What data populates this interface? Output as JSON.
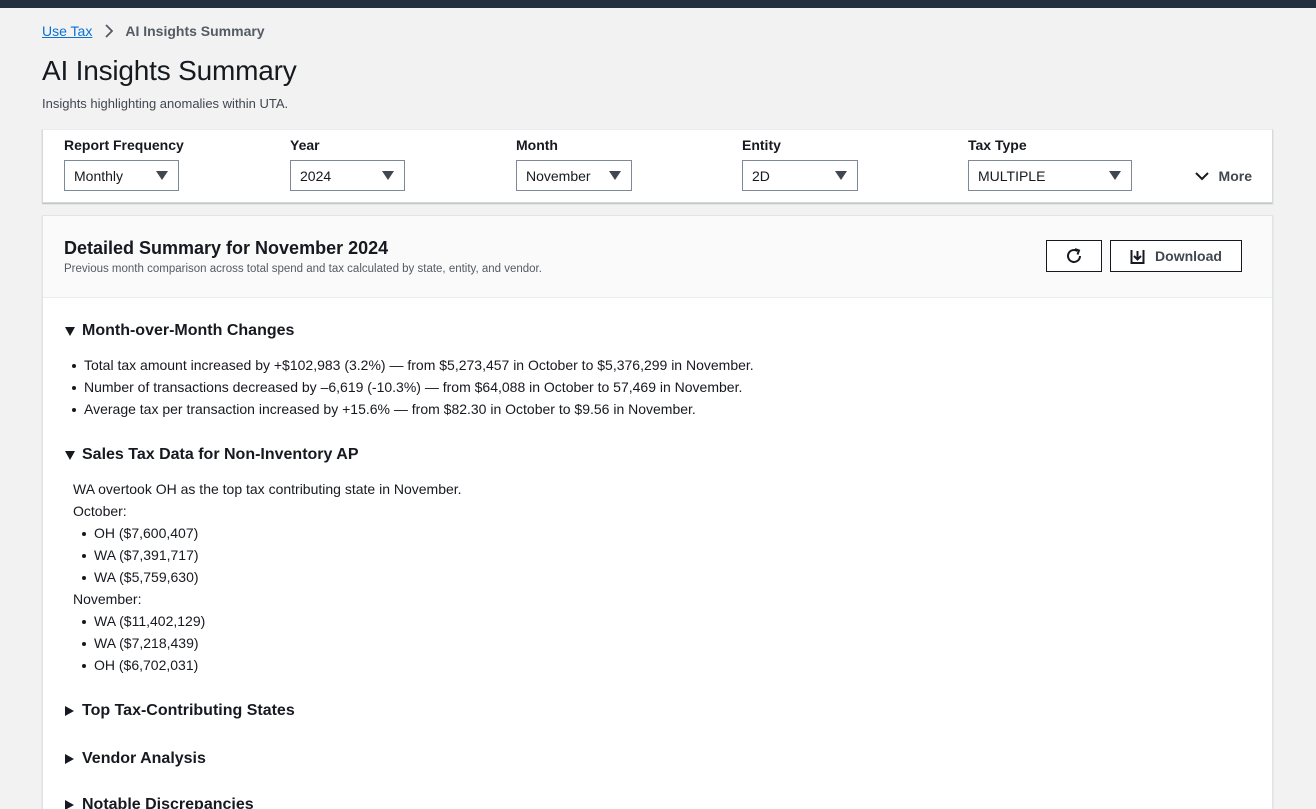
{
  "breadcrumb": {
    "parent": "Use Tax",
    "current": "AI Insights Summary"
  },
  "page": {
    "title": "AI Insights Summary",
    "description": "Insights highlighting anomalies within UTA."
  },
  "filters": {
    "report_frequency": {
      "label": "Report Frequency",
      "value": "Monthly"
    },
    "year": {
      "label": "Year",
      "value": "2024"
    },
    "month": {
      "label": "Month",
      "value": "November"
    },
    "entity": {
      "label": "Entity",
      "value": "2D"
    },
    "tax_type": {
      "label": "Tax Type",
      "value": "MULTIPLE"
    },
    "more_label": "More"
  },
  "summary": {
    "title": "Detailed Summary for November 2024",
    "subtitle": "Previous month comparison across total spend and tax calculated by state, entity, and vendor.",
    "download_label": "Download"
  },
  "sections": {
    "mom": {
      "title": "Month-over-Month Changes",
      "items": [
        "Total tax amount increased by +$102,983 (3.2%) — from $5,273,457 in October to $5,376,299 in November.",
        "Number of transactions decreased by –6,619 (-10.3%) — from $64,088 in October to 57,469 in November.",
        "Average tax per transaction increased by +15.6% — from $82.30 in October to $9.56 in November."
      ]
    },
    "sales": {
      "title": "Sales Tax Data for Non-Inventory AP",
      "intro": "WA overtook OH as the top tax contributing state in November.",
      "october_label": "October:",
      "october": [
        "OH ($7,600,407)",
        "WA ($7,391,717)",
        "WA ($5,759,630)"
      ],
      "november_label": "November:",
      "november": [
        "WA ($11,402,129)",
        "WA ($7,218,439)",
        "OH ($6,702,031)"
      ]
    },
    "top_states": {
      "title": "Top Tax-Contributing States"
    },
    "vendor": {
      "title": "Vendor Analysis"
    },
    "discrepancies": {
      "title": "Notable Discrepancies"
    }
  }
}
